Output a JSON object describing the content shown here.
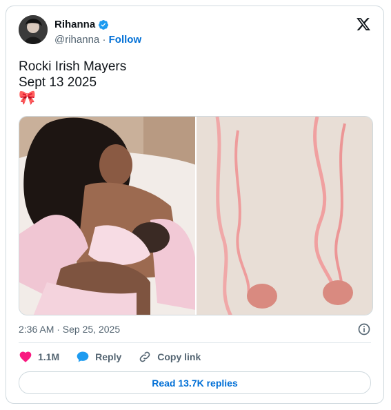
{
  "author": {
    "name": "Rihanna",
    "handle": "@rihanna",
    "separator": "·",
    "follow_label": "Follow"
  },
  "post": {
    "line1": "Rocki Irish Mayers",
    "line2": "Sept 13 2025",
    "emoji": "🎀"
  },
  "media": {
    "photo1_alt": "",
    "photo2_alt": ""
  },
  "meta": {
    "timestamp": "2:36 AM · Sep 25, 2025"
  },
  "actions": {
    "likes": "1.1M",
    "reply_label": "Reply",
    "copy_label": "Copy link"
  },
  "footer": {
    "read_replies": "Read 13.7K replies"
  },
  "colors": {
    "accent": "#006fd6",
    "like": "#f91880",
    "verified": "#1d9bf0",
    "muted": "#536471"
  }
}
